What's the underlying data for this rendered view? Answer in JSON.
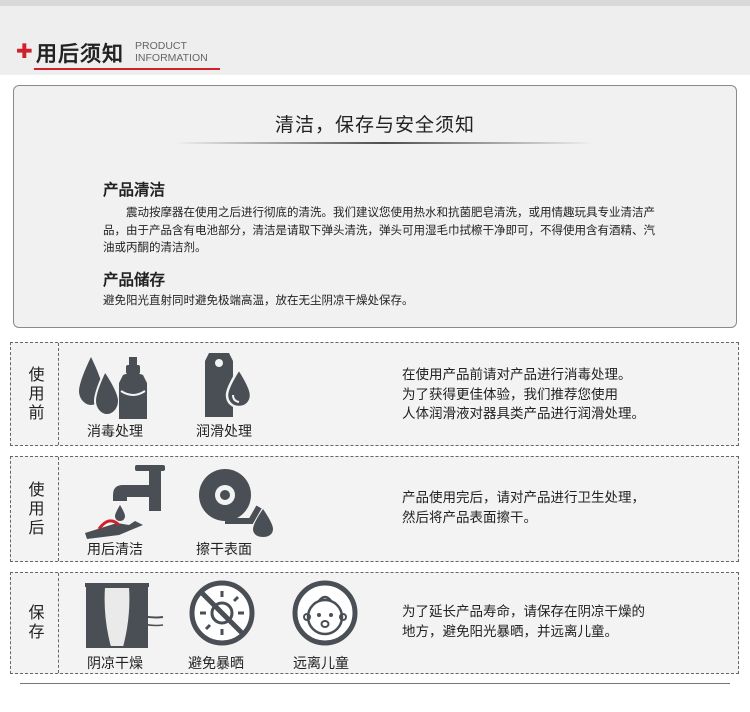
{
  "header": {
    "title": "用后须知",
    "subtitle_en_line1": "PRODUCT",
    "subtitle_en_line2": "INFORMATION"
  },
  "notice": {
    "title": "清洁，保存与安全须知",
    "cleaning": {
      "heading": "产品清洁",
      "text": "　　震动按摩器在使用之后进行彻底的清洗。我们建议您使用热水和抗菌肥皂清洗，或用情趣玩具专业清洁产品，由于产品含有电池部分，清洁是请取下弹头清洗，弹头可用湿毛巾拭檫干净即可，不得使用含有酒精、汽油或丙酮的清洁剂。"
    },
    "storage": {
      "heading": "产品储存",
      "text": "避免阳光直射同时避免极端高温，放在无尘阴凉干燥处保存。"
    }
  },
  "rows": [
    {
      "label": "使用前",
      "items": [
        {
          "icon": "disinfect-drops-spray-icon",
          "caption": "消毒处理"
        },
        {
          "icon": "lubricant-tag-drop-icon",
          "caption": "润滑处理"
        }
      ],
      "description": "在使用产品前请对产品进行消毒处理。\n为了获得更佳体验，我们推荐您使用\n人体润滑液对器具类产品进行润滑处理。"
    },
    {
      "label": "使用后",
      "items": [
        {
          "icon": "faucet-wash-icon",
          "caption": "用后清洁"
        },
        {
          "icon": "tissue-roll-icon",
          "caption": "擦干表面"
        }
      ],
      "description": "产品使用完后，请对产品进行卫生处理，\n然后将产品表面擦干。"
    },
    {
      "label": "保存",
      "items": [
        {
          "icon": "curtain-shade-icon",
          "caption": "阴凉干燥"
        },
        {
          "icon": "no-sun-icon",
          "caption": "避免暴晒"
        },
        {
          "icon": "baby-face-icon",
          "caption": "远离儿童"
        }
      ],
      "description": "为了延长产品寿命，请保存在阴凉干燥的\n地方，避免阳光暴晒，并远离儿童。"
    }
  ],
  "colors": {
    "accent": "#d0202a",
    "icon": "#4a4f55",
    "panel": "#f1f1f1"
  }
}
